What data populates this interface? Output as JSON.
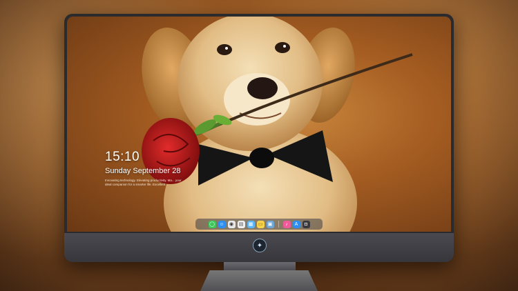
{
  "lockscreen": {
    "time": "15:10",
    "date": "Sunday September 28",
    "tagline": "Innovating technology. Elevating productivity. Ma... your ideal companion for a smarter life. Excellent..."
  },
  "dock": {
    "apps": [
      {
        "name": "messages-icon",
        "color": "#3cc75a",
        "glyph": "◯"
      },
      {
        "name": "finder-icon",
        "color": "#2f8ff0",
        "glyph": "☺"
      },
      {
        "name": "chrome-icon",
        "color": "#e8e8e8",
        "glyph": "◉"
      },
      {
        "name": "notes-icon",
        "color": "#f0f0f0",
        "glyph": "▤"
      },
      {
        "name": "clapper-icon",
        "color": "#5ab4f5",
        "glyph": "▦"
      },
      {
        "name": "stickies-icon",
        "color": "#f6d24a",
        "glyph": "▭"
      },
      {
        "name": "preview-icon",
        "color": "#6fa6d8",
        "glyph": "▣"
      },
      {
        "name": "music-icon",
        "color": "#f05a9a",
        "glyph": "♪"
      },
      {
        "name": "app-store-icon",
        "color": "#2e8ef0",
        "glyph": "A"
      },
      {
        "name": "camera-icon",
        "color": "#3a3a3e",
        "glyph": "◘"
      }
    ]
  },
  "monitor": {
    "logo_icon": "brand-logo-icon"
  }
}
